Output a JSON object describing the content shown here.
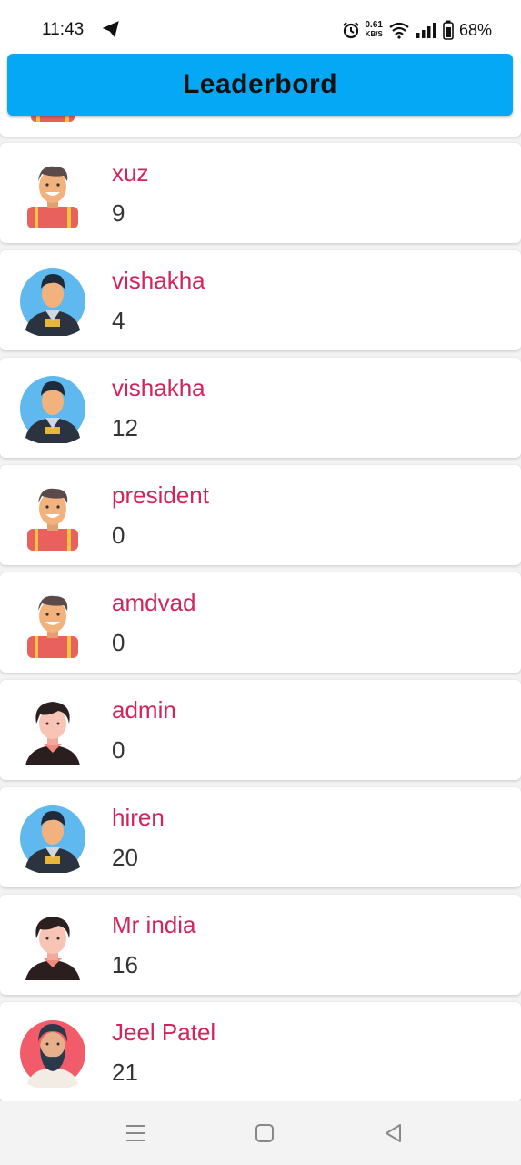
{
  "status": {
    "time": "11:43",
    "net_speed_value": "0.61",
    "net_speed_unit": "KB/S",
    "battery": "68%"
  },
  "header": {
    "title": "Leaderbord"
  },
  "entries": [
    {
      "name": "",
      "score": "",
      "avatar": "man-red-shirt"
    },
    {
      "name": "xuz",
      "score": "9",
      "avatar": "man-red-shirt"
    },
    {
      "name": "vishakha",
      "score": "4",
      "avatar": "man-blue-circle"
    },
    {
      "name": "vishakha",
      "score": "12",
      "avatar": "man-blue-circle"
    },
    {
      "name": "president",
      "score": "0",
      "avatar": "man-red-shirt"
    },
    {
      "name": "amdvad",
      "score": "0",
      "avatar": "man-red-shirt"
    },
    {
      "name": "admin",
      "score": "0",
      "avatar": "boy-dark-hair"
    },
    {
      "name": "hiren",
      "score": "20",
      "avatar": "man-blue-circle"
    },
    {
      "name": "Mr india",
      "score": "16",
      "avatar": "boy-dark-hair"
    },
    {
      "name": "Jeel Patel",
      "score": "21",
      "avatar": "bearded-man-red-circle"
    }
  ],
  "navbar": {
    "icons": [
      "menu-icon",
      "home-square-icon",
      "back-triangle-icon"
    ]
  }
}
